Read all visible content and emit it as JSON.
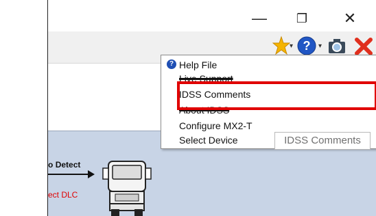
{
  "window": {
    "minimize_glyph": "—",
    "restore_glyph": "❐",
    "close_glyph": "✕"
  },
  "toolbar": {
    "icons": [
      "star-icon",
      "help-icon",
      "camera-icon",
      "close-red-icon"
    ],
    "dropdown_glyph": "▾"
  },
  "help_menu": {
    "items": [
      {
        "label": "Help File"
      },
      {
        "label": "Live Support"
      },
      {
        "label": "IDSS Comments"
      },
      {
        "label": "About IDSS"
      },
      {
        "label": "Configure MX2-T"
      },
      {
        "label": "Select Device"
      }
    ],
    "tooltip": "IDSS Comments"
  },
  "diagram": {
    "detect_label": "Detect",
    "detect_prefix": "o",
    "dlc_label": "ect DLC"
  },
  "colors": {
    "highlight": "#e00000",
    "blue_panel": "#c8d4e6",
    "help_blue": "#1f4fb4"
  }
}
